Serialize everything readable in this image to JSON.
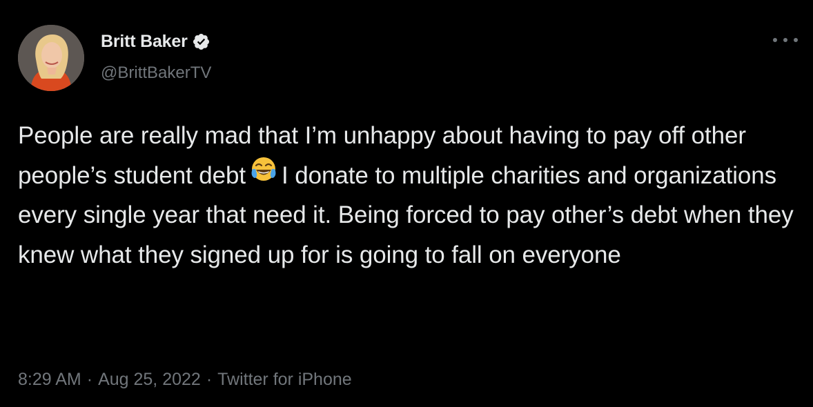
{
  "author": {
    "display_name": "Britt Baker",
    "handle": "@BrittBakerTV",
    "verified_icon": "verified-badge-icon",
    "avatar_icon": "profile-photo"
  },
  "menu": {
    "icon": "more-options-icon"
  },
  "tweet": {
    "text_part1": "People are really mad that I’m unhappy about having to pay off other people’s student debt",
    "emoji": "face-with-tears-of-joy-icon",
    "text_part2": "I donate to multiple charities and organizations every single year that need it. Being forced to pay other’s debt when they knew what they signed up for is going to fall on everyone"
  },
  "meta": {
    "time": "8:29 AM",
    "date": "Aug 25, 2022",
    "source": "Twitter for iPhone",
    "separator": "·"
  },
  "colors": {
    "background": "#000000",
    "primary_text": "#e7e9ea",
    "secondary_text": "#71767b"
  }
}
